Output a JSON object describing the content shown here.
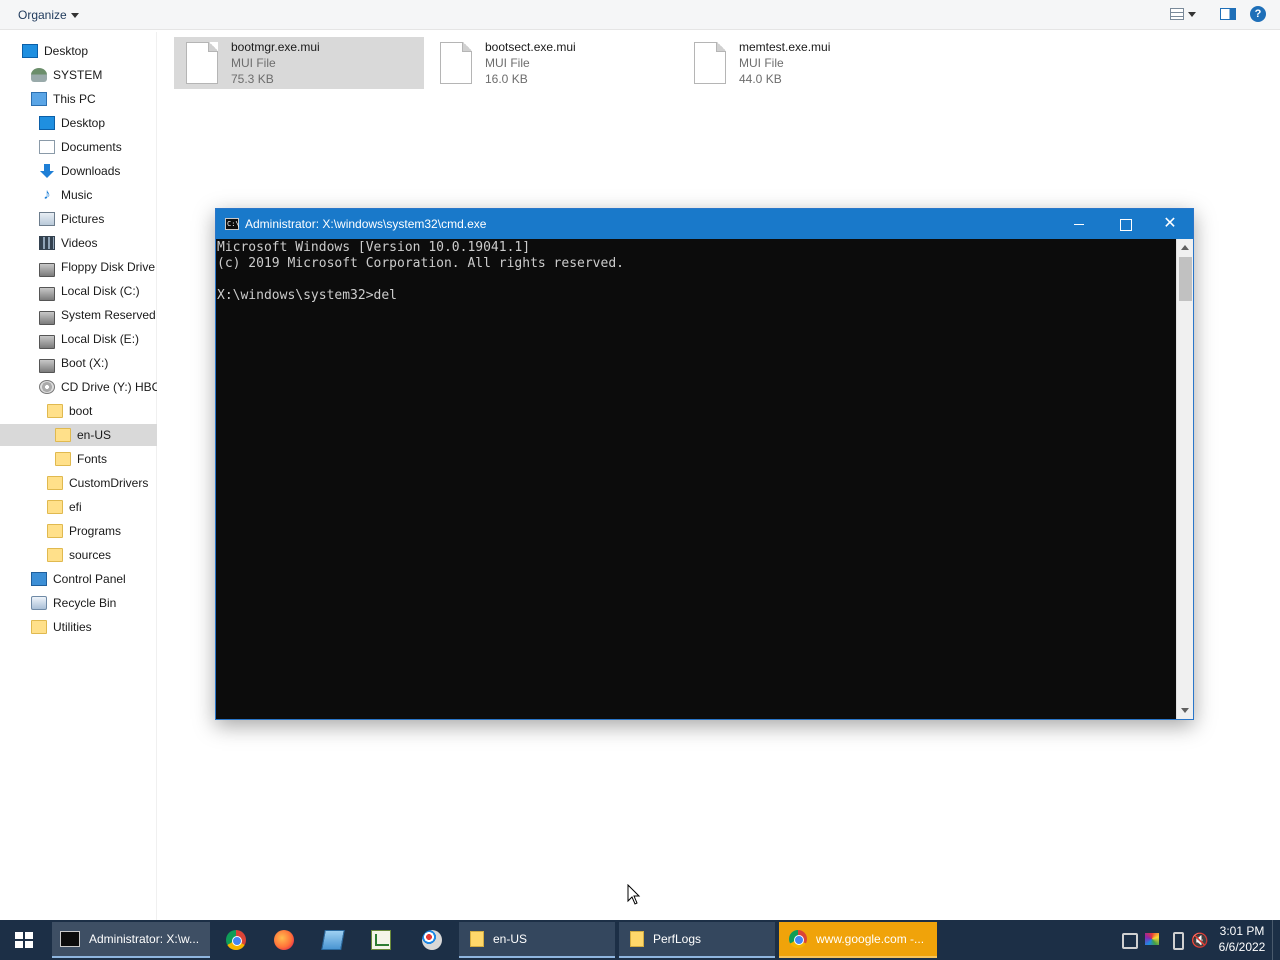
{
  "toolbar": {
    "organize_label": "Organize",
    "icons": [
      "view-options-icon",
      "preview-pane-icon",
      "help-icon"
    ],
    "help_glyph": "?"
  },
  "nav": {
    "items": [
      {
        "label": "Desktop",
        "icon": "desktop-icon"
      },
      {
        "label": "SYSTEM",
        "icon": "user-icon"
      },
      {
        "label": "This PC",
        "icon": "pc-icon"
      },
      {
        "label": "Desktop",
        "icon": "desktop-icon"
      },
      {
        "label": "Documents",
        "icon": "documents-icon"
      },
      {
        "label": "Downloads",
        "icon": "downloads-icon"
      },
      {
        "label": "Music",
        "icon": "music-icon"
      },
      {
        "label": "Pictures",
        "icon": "pictures-icon"
      },
      {
        "label": "Videos",
        "icon": "videos-icon"
      },
      {
        "label": "Floppy Disk Drive",
        "icon": "drive-icon"
      },
      {
        "label": "Local Disk (C:)",
        "icon": "drive-icon"
      },
      {
        "label": "System Reserved (",
        "icon": "drive-icon"
      },
      {
        "label": "Local Disk (E:)",
        "icon": "drive-icon"
      },
      {
        "label": "Boot (X:)",
        "icon": "drive-icon"
      },
      {
        "label": "CD Drive (Y:) HBC",
        "icon": "cd-drive-icon"
      },
      {
        "label": "boot",
        "icon": "folder-icon"
      },
      {
        "label": "en-US",
        "icon": "folder-icon",
        "selected": true
      },
      {
        "label": "Fonts",
        "icon": "folder-icon"
      },
      {
        "label": "CustomDrivers",
        "icon": "folder-icon"
      },
      {
        "label": "efi",
        "icon": "folder-icon"
      },
      {
        "label": "Programs",
        "icon": "folder-icon"
      },
      {
        "label": "sources",
        "icon": "folder-icon"
      },
      {
        "label": "Control Panel",
        "icon": "control-panel-icon"
      },
      {
        "label": "Recycle Bin",
        "icon": "recycle-bin-icon"
      },
      {
        "label": "Utilities",
        "icon": "folder-icon"
      }
    ]
  },
  "files": [
    {
      "name": "bootmgr.exe.mui",
      "type": "MUI File",
      "size": "75.3 KB",
      "selected": true
    },
    {
      "name": "bootsect.exe.mui",
      "type": "MUI File",
      "size": "16.0 KB"
    },
    {
      "name": "memtest.exe.mui",
      "type": "MUI File",
      "size": "44.0 KB"
    }
  ],
  "cmd": {
    "title": "Administrator: X:\\windows\\system32\\cmd.exe",
    "icon_glyph": "C:\\",
    "close_glyph": "✕",
    "lines": [
      "Microsoft Windows [Version 10.0.19041.1]",
      "(c) 2019 Microsoft Corporation. All rights reserved.",
      "",
      "X:\\windows\\system32>del"
    ]
  },
  "taskbar": {
    "tasks": [
      {
        "label": "Administrator: X:\\w...",
        "icon": "cmd-icon",
        "state": "active"
      },
      {
        "label": "en-US",
        "icon": "folder-icon",
        "state": "open"
      },
      {
        "label": "PerfLogs",
        "icon": "folder-icon",
        "state": "open"
      },
      {
        "label": "www.google.com -...",
        "icon": "chrome-icon",
        "state": "flash"
      }
    ],
    "pinned": [
      "chrome-icon",
      "firefox-icon",
      "notepad-icon",
      "chart-icon",
      "paint-icon"
    ],
    "tray": {
      "icons": [
        "network-icon",
        "color-icon",
        "usb-icon",
        "volume-muted-icon"
      ],
      "volume_glyph": "🔇",
      "time": "3:01 PM",
      "date": "6/6/2022"
    }
  },
  "colors": {
    "cmd_title_bg": "#1979ca",
    "console_bg": "#0c0c0c",
    "console_fg": "#cccccc",
    "taskbar_bg": "#1c2f46",
    "flash_task": "#f0a30a",
    "selection": "#d9d9d9"
  }
}
